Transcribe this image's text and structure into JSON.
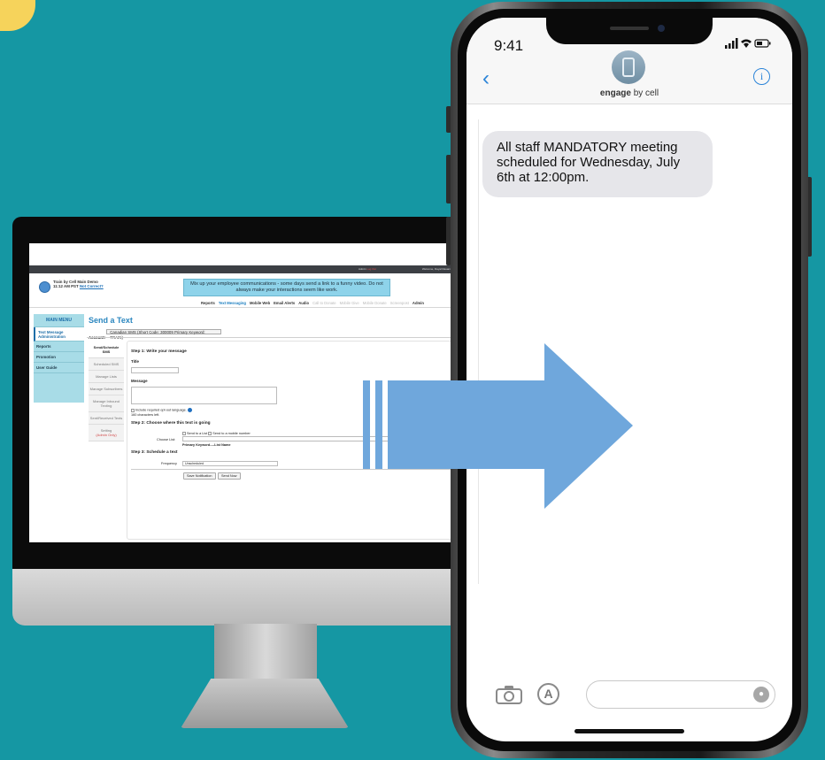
{
  "monitor": {
    "topbar": {
      "admin_label": "Admin",
      "admin_sub": "Log Out",
      "welcome": "Welcome, Dayal Rasam"
    },
    "brand": {
      "line1": "Train by Cell Main Demo",
      "time": "11:12 AM PST",
      "link": "Not Correct?"
    },
    "promo": "Mix up your employee communications - some days send a link to a funny video. Do not always make your interactions seem like work.",
    "nav_tabs": [
      {
        "label": "Reports",
        "state": "normal"
      },
      {
        "label": "Text Messaging",
        "state": "active"
      },
      {
        "label": "Mobile Web",
        "state": "normal"
      },
      {
        "label": "Email Alerts",
        "state": "normal"
      },
      {
        "label": "Audio",
        "state": "normal"
      },
      {
        "label": "Call to Donate",
        "state": "dim"
      },
      {
        "label": "Mobile Give",
        "state": "dim"
      },
      {
        "label": "Mobile Donate",
        "state": "dim"
      },
      {
        "label": "Screenpost",
        "state": "dim"
      },
      {
        "label": "Admin",
        "state": "normal"
      }
    ],
    "sidebar": {
      "title": "MAIN MENU",
      "items": [
        "Text Message Administration",
        "Reports",
        "Promotion",
        "User Guide"
      ]
    },
    "page_title": "Send a Text",
    "account_label": "Account:",
    "account_value": "Canadian SMS (Short Code: 300009 Primary Keyword: TRAIN)",
    "subnav": [
      "Send/Schedule SMS",
      "Scheduled SMS",
      "Manage Lists",
      "Manage Subscribers",
      "Manage Inbound Texting",
      "Sent/Received Texts",
      "Setting",
      "(Admin Only)"
    ],
    "form": {
      "step1": "Step 1: Write your message",
      "title_label": "Title",
      "message_label": "Message",
      "optout": "Include required opt-out language.",
      "chars_left": "160 characters left.",
      "step2": "Step 2: Choose where this text is going",
      "send_list": "Send to a List",
      "send_number": "Send to a mobile number",
      "choose_list": "Choose List:",
      "list_header": "Primary Keyword----List Name",
      "step3": "Step 3: Schedule a text",
      "frequency_label": "Frequency",
      "frequency_value": "Unscheduled",
      "save_btn": "Save Notification",
      "send_btn": "Send Now"
    }
  },
  "phone": {
    "time": "9:41",
    "contact_bold": "engage",
    "contact_rest": " by cell",
    "message": "All staff MANDATORY meeting scheduled for Wednesday, July 6th at 12:00pm.",
    "status_icons": "signal wifi battery"
  },
  "colors": {
    "background": "#1597a3",
    "arrow": "#6fa7dc",
    "promo": "#8ed3ea",
    "sidebar": "#a8dce7",
    "accent": "#2b84d8"
  }
}
